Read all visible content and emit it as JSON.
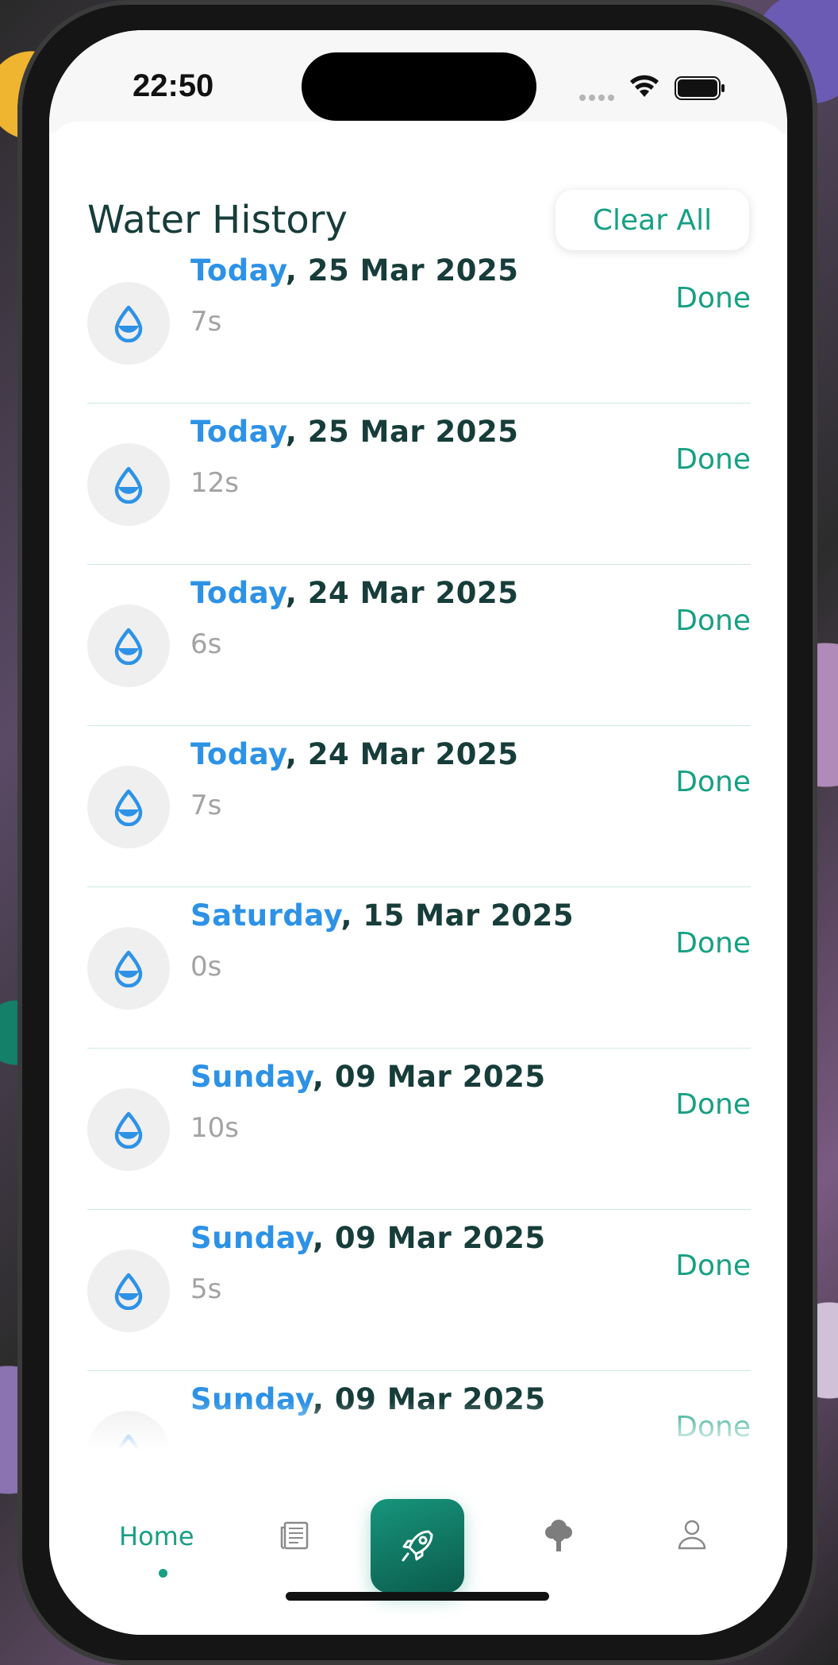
{
  "status_bar": {
    "time": "22:50"
  },
  "header": {
    "title": "Water History",
    "clear_all": "Clear All"
  },
  "entries": [
    {
      "day": "Today",
      "date": ", 25 Mar 2025",
      "duration": "7s",
      "status": "Done"
    },
    {
      "day": "Today",
      "date": ", 25 Mar 2025",
      "duration": "12s",
      "status": "Done"
    },
    {
      "day": "Today",
      "date": ", 24 Mar 2025",
      "duration": "6s",
      "status": "Done"
    },
    {
      "day": "Today",
      "date": ", 24 Mar 2025",
      "duration": "7s",
      "status": "Done"
    },
    {
      "day": "Saturday",
      "date": ", 15 Mar 2025",
      "duration": "0s",
      "status": "Done"
    },
    {
      "day": "Sunday",
      "date": ", 09 Mar 2025",
      "duration": "10s",
      "status": "Done"
    },
    {
      "day": "Sunday",
      "date": ", 09 Mar 2025",
      "duration": "5s",
      "status": "Done"
    },
    {
      "day": "Sunday",
      "date": ", 09 Mar 2025",
      "duration": "",
      "status": "Done"
    }
  ],
  "tabbar": {
    "home_label": "Home",
    "icons": [
      "news-icon",
      "rocket-icon",
      "tree-icon",
      "profile-icon"
    ]
  },
  "colors": {
    "accent": "#17a083",
    "day_blue": "#2d92e6",
    "title_dark": "#173d3a"
  }
}
